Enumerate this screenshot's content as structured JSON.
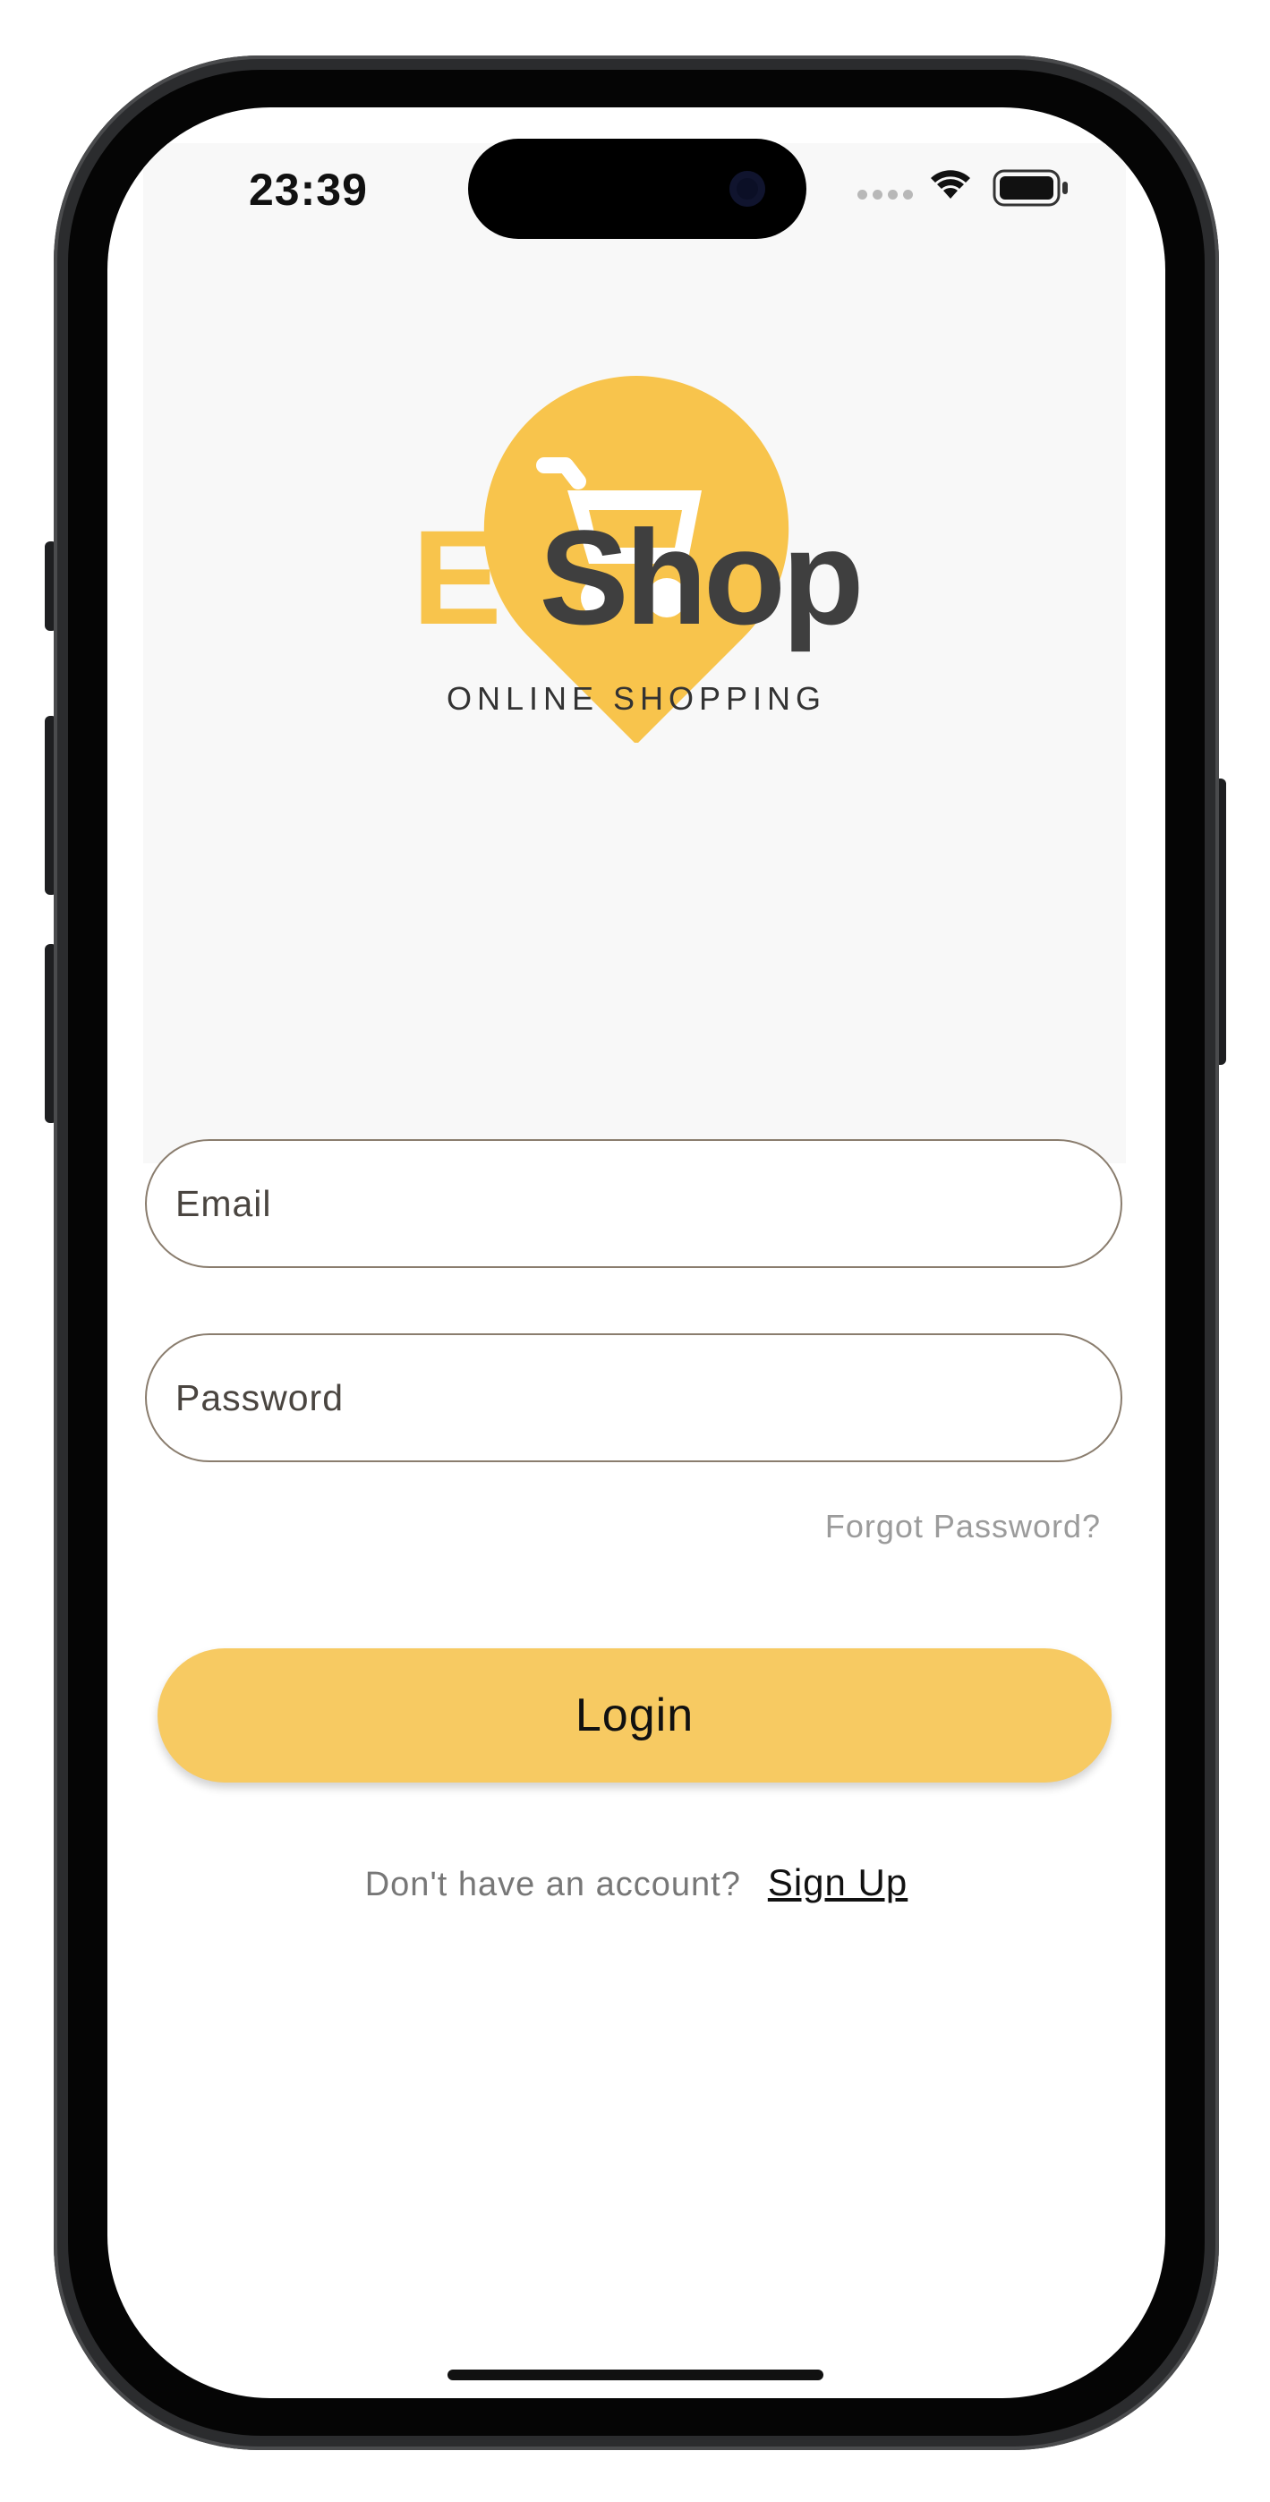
{
  "status_bar": {
    "time": "23:39"
  },
  "brand": {
    "prefix": "E-",
    "name": "Shop",
    "tagline": "ONLINE SHOPPING"
  },
  "colors": {
    "accent": "#f8c44c",
    "button": "#f7ca62",
    "brand_dark": "#3f3f3f"
  },
  "form": {
    "email_placeholder": "Email",
    "password_placeholder": "Password",
    "forgot_label": "Forgot Password?",
    "login_label": "Login"
  },
  "footer": {
    "question": "Don't have an account?",
    "signup_label": "Sign Up"
  },
  "icons": [
    "cart-pin-logo",
    "wifi-icon",
    "battery-icon",
    "signal-icon"
  ]
}
